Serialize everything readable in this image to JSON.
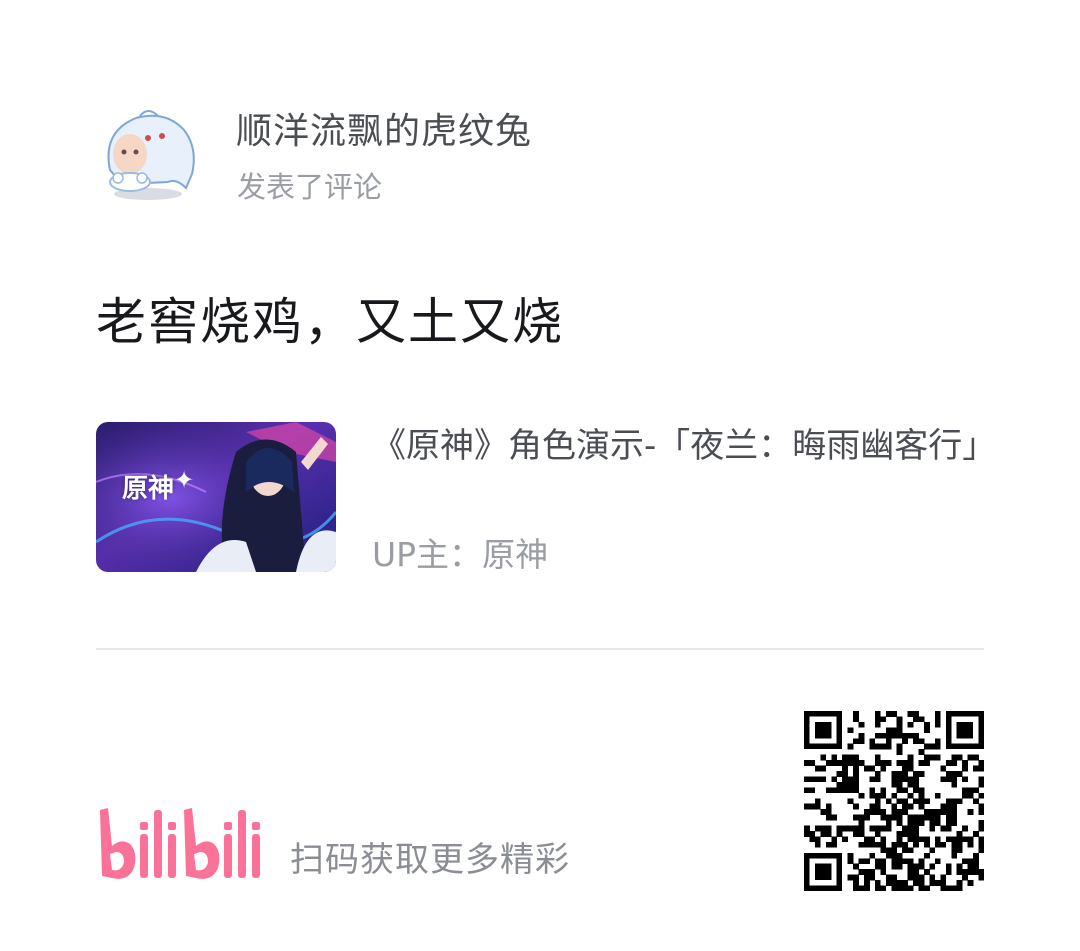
{
  "post": {
    "username": "顺洋流飘的虎纹兔",
    "action_text": "发表了评论",
    "comment": "老窖烧鸡，又土又烧"
  },
  "video": {
    "title": "《原神》角色演示-「夜兰：晦雨幽客行」",
    "uploader_label": "UP主：",
    "uploader_name": "原神",
    "thumbnail_logo_text": "原神",
    "thumbnail_icon": "genshin-promo-thumbnail"
  },
  "footer": {
    "brand_logo_text": "bilibili",
    "slogan": "扫码获取更多精彩",
    "qr_icon": "qr-code"
  },
  "colors": {
    "brand_pink": "#fb7299",
    "text_primary": "#18191c",
    "text_secondary": "#9a9da3"
  }
}
